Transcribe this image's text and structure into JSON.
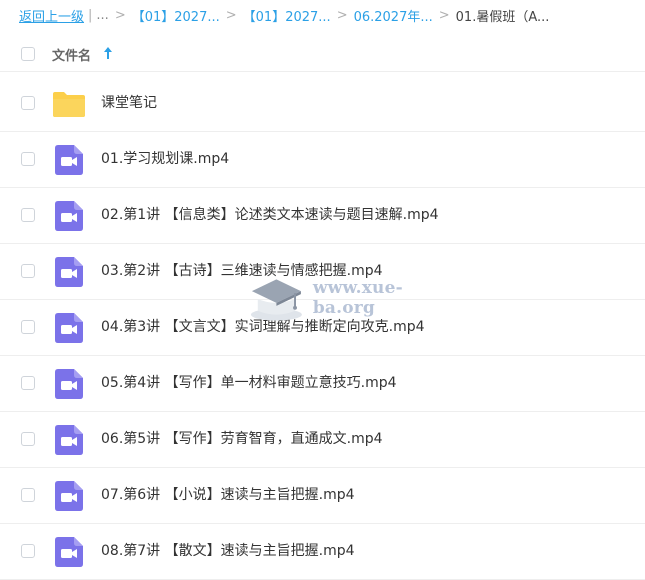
{
  "breadcrumb": {
    "back": "返回上一级",
    "pipe": "|",
    "ellipsis": "...",
    "sep": ">",
    "crumbs": [
      "【01】2027...",
      "【01】2027...",
      "06.2027年..."
    ],
    "current": "01.暑假班（A..."
  },
  "header": {
    "name_label": "文件名",
    "sort_icon": "arrow-up-icon"
  },
  "files": [
    {
      "name": "课堂笔记",
      "type": "folder",
      "icon": "folder-icon"
    },
    {
      "name": "01.学习规划课.mp4",
      "type": "video",
      "icon": "video-file-icon"
    },
    {
      "name": "02.第1讲 【信息类】论述类文本速读与题目速解.mp4",
      "type": "video",
      "icon": "video-file-icon"
    },
    {
      "name": "03.第2讲 【古诗】三维速读与情感把握.mp4",
      "type": "video",
      "icon": "video-file-icon"
    },
    {
      "name": "04.第3讲 【文言文】实词理解与推断定向攻克.mp4",
      "type": "video",
      "icon": "video-file-icon"
    },
    {
      "name": "05.第4讲 【写作】单一材料审题立意技巧.mp4",
      "type": "video",
      "icon": "video-file-icon"
    },
    {
      "name": "06.第5讲 【写作】劳育智育，直通成文.mp4",
      "type": "video",
      "icon": "video-file-icon"
    },
    {
      "name": "07.第6讲 【小说】速读与主旨把握.mp4",
      "type": "video",
      "icon": "video-file-icon"
    },
    {
      "name": "08.第7讲 【散文】速读与主旨把握.mp4",
      "type": "video",
      "icon": "video-file-icon"
    }
  ],
  "watermark": {
    "text": "www.xue-ba.org"
  },
  "colors": {
    "link": "#2ba0e6",
    "folder": "#fccf4a",
    "video_icon": "#7b72e9",
    "border": "#eeeeee"
  }
}
